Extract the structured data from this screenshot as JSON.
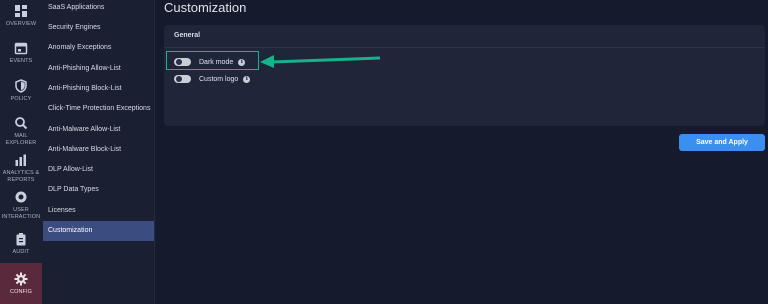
{
  "rail": {
    "items": [
      {
        "label": "OVERVIEW",
        "icon": "dashboard-icon"
      },
      {
        "label": "EVENTS",
        "icon": "calendar-icon"
      },
      {
        "label": "POLICY",
        "icon": "shield-icon"
      },
      {
        "label": "MAIL\nEXPLORER",
        "icon": "search-icon"
      },
      {
        "label": "ANALYTICS &\nREPORTS",
        "icon": "bar-chart-icon"
      },
      {
        "label": "USER\nINTERACTION",
        "icon": "user-interaction-icon"
      },
      {
        "label": "AUDIT",
        "icon": "clipboard-icon"
      },
      {
        "label": "CONFIG",
        "icon": "gear-icon",
        "active": true
      }
    ]
  },
  "submenu": {
    "items": [
      "SaaS Applications",
      "Security Engines",
      "Anomaly Exceptions",
      "Anti-Phishing Allow-List",
      "Anti-Phishing Block-List",
      "Click-Time Protection Exceptions",
      "Anti-Malware Allow-List",
      "Anti-Malware Block-List",
      "DLP Allow-List",
      "DLP Data Types",
      "Licenses",
      "Customization"
    ],
    "active": "Customization"
  },
  "main": {
    "title": "Customization",
    "section": "General",
    "settings": [
      {
        "label": "Dark mode",
        "enabled": true
      },
      {
        "label": "Custom logo",
        "enabled": false
      }
    ],
    "info_glyph": "i",
    "save_label": "Save and Apply"
  },
  "colors": {
    "accent": "#3b8ff0",
    "highlight": "#14b38a",
    "active_submenu": "#3a4c80",
    "active_rail": "#5a2a3c"
  }
}
